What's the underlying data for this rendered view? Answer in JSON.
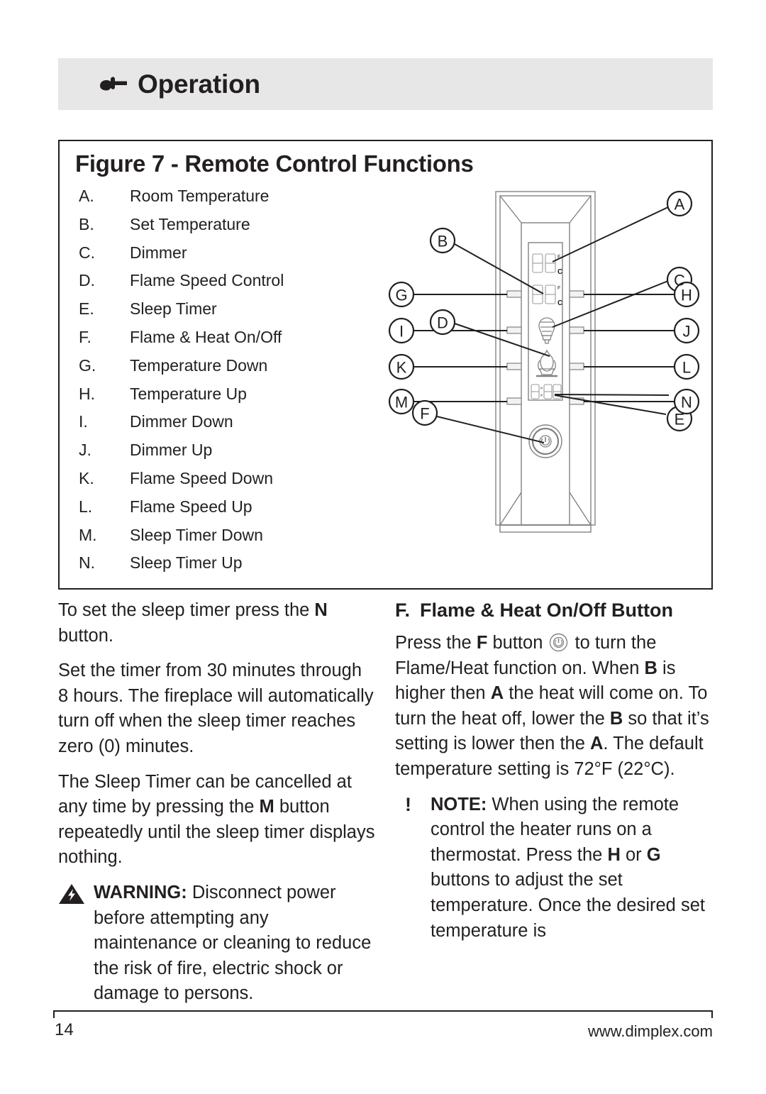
{
  "header": {
    "title": "Operation",
    "icon": "pointing-hand-icon"
  },
  "figure": {
    "title": "Figure 7 - Remote Control Functions",
    "legend": [
      {
        "letter": "A.",
        "label": "Room Temperature"
      },
      {
        "letter": "B.",
        "label": "Set Temperature"
      },
      {
        "letter": "C.",
        "label": "Dimmer"
      },
      {
        "letter": "D.",
        "label": "Flame Speed Control"
      },
      {
        "letter": "E.",
        "label": "Sleep Timer"
      },
      {
        "letter": "F.",
        "label": "Flame & Heat On/Off"
      },
      {
        "letter": "G.",
        "label": "Temperature Down"
      },
      {
        "letter": "H.",
        "label": "Temperature Up"
      },
      {
        "letter": "I.",
        "label": "Dimmer Down"
      },
      {
        "letter": "J.",
        "label": "Dimmer Up"
      },
      {
        "letter": "K.",
        "label": "Flame Speed Down"
      },
      {
        "letter": "L.",
        "label": "Flame Speed Up"
      },
      {
        "letter": "M.",
        "label": "Sleep Timer Down"
      },
      {
        "letter": "N.",
        "label": "Sleep Timer Up"
      }
    ],
    "callouts": {
      "a": "A",
      "b": "B",
      "c": "C",
      "d": "D",
      "e": "E",
      "f": "F",
      "g": "G",
      "h": "H",
      "i": "I",
      "j": "J",
      "k": "K",
      "l": "L",
      "m": "M",
      "n": "N"
    },
    "display": {
      "room_temp_unit_f": "F",
      "room_temp_unit_c": "C",
      "set_temp_unit_f": "F",
      "set_temp_unit_c": "C"
    }
  },
  "left_column": {
    "p1_pre": "To set the sleep timer press the ",
    "p1_bold": "N",
    "p1_post": " button.",
    "p2": "Set the timer from 30 minutes through 8 hours.  The fireplace will automatically turn off when the sleep timer reaches zero (0) minutes.",
    "p3_pre": "The Sleep Timer can be cancelled at any time by pressing the ",
    "p3_bold": "M",
    "p3_post": " button repeatedly until the sleep timer displays nothing.",
    "warning_title": "WARNING:",
    "warning_body": "  Disconnect power before attempting any maintenance or cleaning to reduce the risk of fire, electric shock or damage to persons."
  },
  "right_column": {
    "heading_letter": "F.",
    "heading_text": "Flame & Heat On/Off Button",
    "p1_a": "Press the ",
    "p1_b_f": "F",
    "p1_c": " button ",
    "p1_d": " to turn the Flame/Heat function on.  When ",
    "p1_b_b": "B",
    "p1_e": " is higher then ",
    "p1_b_a1": "A",
    "p1_f": " the heat will come on.  To turn the heat off, lower the ",
    "p1_b_b2": "B",
    "p1_g": " so that it’s setting is lower then the ",
    "p1_b_a2": "A",
    "p1_h": ".  The default temperature setting is 72°F (22°C).",
    "note_marker": "!",
    "note_title": "NOTE:",
    "note_a": "  When using the remote control the heater runs on a thermostat. Press the ",
    "note_b_h": "H",
    "note_b": " or ",
    "note_b_g": "G",
    "note_c": " buttons to adjust the set temperature.  Once the desired set temperature is"
  },
  "footer": {
    "page_number": "14",
    "website": "www.dimplex.com"
  },
  "colors": {
    "header_bg": "#e7e7e8",
    "ink": "#231f20",
    "diagram_line": "#58595b",
    "callout_line": "#231f20"
  }
}
